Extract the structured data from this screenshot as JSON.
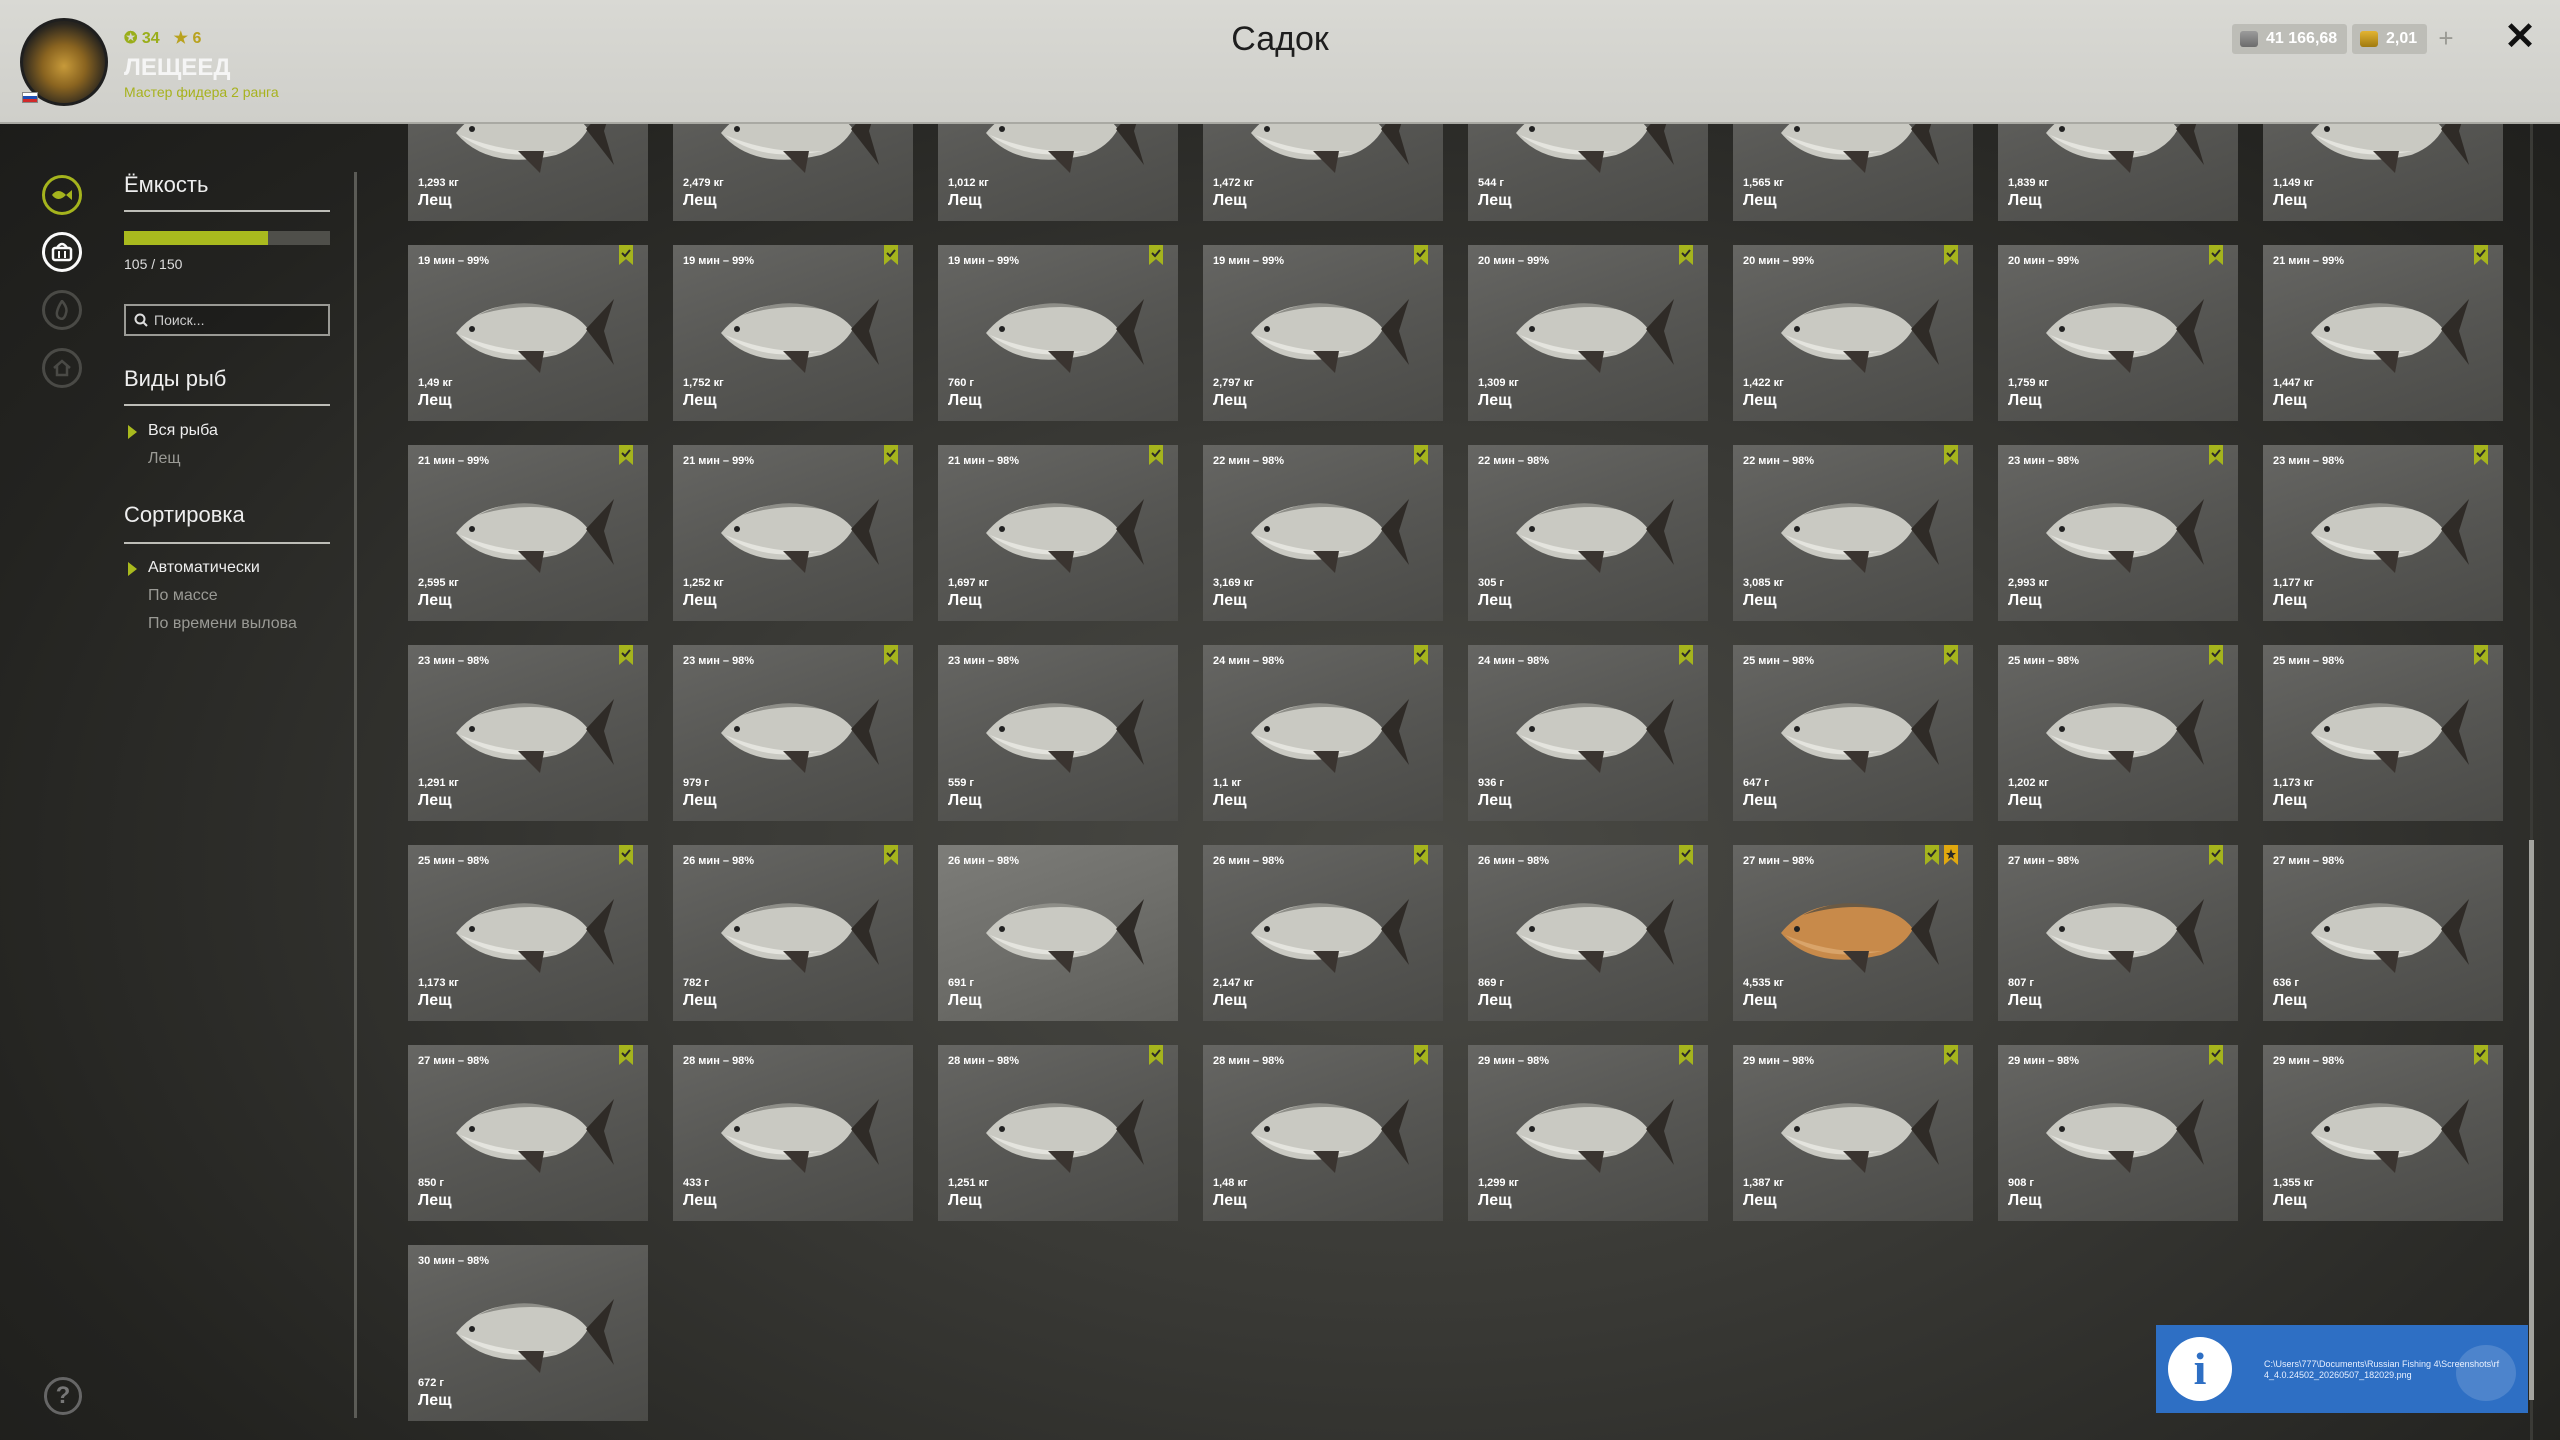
{
  "header": {
    "title": "Садок",
    "player": {
      "name": "ЛЕЩЕЕД",
      "rank": "Мастер фидера 2 ранга",
      "level": "34",
      "rank_stars": "6"
    },
    "silver": "41 166,68",
    "gold": "2,01"
  },
  "sidebar": {
    "capacity_title": "Ёмкость",
    "capacity_text": "105 / 150",
    "capacity_fraction": 0.7,
    "search_placeholder": "Поиск...",
    "species_title": "Виды рыб",
    "species": [
      "Вся рыба",
      "Лещ"
    ],
    "sort_title": "Сортировка",
    "sort_options": [
      "Автоматически",
      "По массе",
      "По времени вылова"
    ]
  },
  "notification": {
    "text": "C:\\Users\\777\\Documents\\Russian Fishing 4\\Screenshots\\rf4_4.0.24502_20260507_182029.png"
  },
  "cards": [
    {
      "time": "",
      "weight": "1,293 кг",
      "name": "Лещ"
    },
    {
      "time": "",
      "weight": "2,479 кг",
      "name": "Лещ"
    },
    {
      "time": "",
      "weight": "1,012 кг",
      "name": "Лещ"
    },
    {
      "time": "",
      "weight": "1,472 кг",
      "name": "Лещ"
    },
    {
      "time": "",
      "weight": "544 г",
      "name": "Лещ"
    },
    {
      "time": "",
      "weight": "1,565 кг",
      "name": "Лещ"
    },
    {
      "time": "",
      "weight": "1,839 кг",
      "name": "Лещ"
    },
    {
      "time": "",
      "weight": "1,149 кг",
      "name": "Лещ"
    },
    {
      "time": "19 мин – 99%",
      "weight": "1,49 кг",
      "name": "Лещ"
    },
    {
      "time": "19 мин – 99%",
      "weight": "1,752 кг",
      "name": "Лещ"
    },
    {
      "time": "19 мин – 99%",
      "weight": "760 г",
      "name": "Лещ"
    },
    {
      "time": "19 мин – 99%",
      "weight": "2,797 кг",
      "name": "Лещ"
    },
    {
      "time": "20 мин – 99%",
      "weight": "1,309 кг",
      "name": "Лещ"
    },
    {
      "time": "20 мин – 99%",
      "weight": "1,422 кг",
      "name": "Лещ"
    },
    {
      "time": "20 мин – 99%",
      "weight": "1,759 кг",
      "name": "Лещ"
    },
    {
      "time": "21 мин – 99%",
      "weight": "1,447 кг",
      "name": "Лещ"
    },
    {
      "time": "21 мин – 99%",
      "weight": "2,595 кг",
      "name": "Лещ"
    },
    {
      "time": "21 мин – 99%",
      "weight": "1,252 кг",
      "name": "Лещ"
    },
    {
      "time": "21 мин – 98%",
      "weight": "1,697 кг",
      "name": "Лещ"
    },
    {
      "time": "22 мин – 98%",
      "weight": "3,169 кг",
      "name": "Лещ"
    },
    {
      "time": "22 мин – 98%",
      "weight": "305 г",
      "name": "Лещ",
      "nobadge": true
    },
    {
      "time": "22 мин – 98%",
      "weight": "3,085 кг",
      "name": "Лещ"
    },
    {
      "time": "23 мин – 98%",
      "weight": "2,993 кг",
      "name": "Лещ"
    },
    {
      "time": "23 мин – 98%",
      "weight": "1,177 кг",
      "name": "Лещ"
    },
    {
      "time": "23 мин – 98%",
      "weight": "1,291 кг",
      "name": "Лещ"
    },
    {
      "time": "23 мин – 98%",
      "weight": "979 г",
      "name": "Лещ"
    },
    {
      "time": "23 мин – 98%",
      "weight": "559 г",
      "name": "Лещ",
      "nobadge": true
    },
    {
      "time": "24 мин – 98%",
      "weight": "1,1 кг",
      "name": "Лещ"
    },
    {
      "time": "24 мин – 98%",
      "weight": "936 г",
      "name": "Лещ"
    },
    {
      "time": "25 мин – 98%",
      "weight": "647 г",
      "name": "Лещ"
    },
    {
      "time": "25 мин – 98%",
      "weight": "1,202 кг",
      "name": "Лещ"
    },
    {
      "time": "25 мин – 98%",
      "weight": "1,173 кг",
      "name": "Лещ"
    },
    {
      "time": "25 мин – 98%",
      "weight": "1,173 кг",
      "name": "Лещ"
    },
    {
      "time": "26 мин – 98%",
      "weight": "782 г",
      "name": "Лещ"
    },
    {
      "time": "26 мин – 98%",
      "weight": "691 г",
      "name": "Лещ",
      "nobadge": true,
      "light": true
    },
    {
      "time": "26 мин – 98%",
      "weight": "2,147 кг",
      "name": "Лещ"
    },
    {
      "time": "26 мин – 98%",
      "weight": "869 г",
      "name": "Лещ"
    },
    {
      "time": "27 мин – 98%",
      "weight": "4,535 кг",
      "name": "Лещ",
      "trophy": true
    },
    {
      "time": "27 мин – 98%",
      "weight": "807 г",
      "name": "Лещ"
    },
    {
      "time": "27 мин – 98%",
      "weight": "636 г",
      "name": "Лещ",
      "nobadge": true
    },
    {
      "time": "27 мин – 98%",
      "weight": "850 г",
      "name": "Лещ"
    },
    {
      "time": "28 мин – 98%",
      "weight": "433 г",
      "name": "Лещ",
      "nobadge": true
    },
    {
      "time": "28 мин – 98%",
      "weight": "1,251 кг",
      "name": "Лещ"
    },
    {
      "time": "28 мин – 98%",
      "weight": "1,48 кг",
      "name": "Лещ"
    },
    {
      "time": "29 мин – 98%",
      "weight": "1,299 кг",
      "name": "Лещ"
    },
    {
      "time": "29 мин – 98%",
      "weight": "1,387 кг",
      "name": "Лещ"
    },
    {
      "time": "29 мин – 98%",
      "weight": "908 г",
      "name": "Лещ"
    },
    {
      "time": "29 мин – 98%",
      "weight": "1,355 кг",
      "name": "Лещ"
    },
    {
      "time": "30 мин – 98%",
      "weight": "672 г",
      "name": "Лещ",
      "nobadge": true
    }
  ],
  "icons": {
    "fish_tank_tab": "fish-icon",
    "keepnet_tab": "basket-icon",
    "badge_color": "#a5b41d",
    "trophy_badge_color": "#e0a80f"
  }
}
